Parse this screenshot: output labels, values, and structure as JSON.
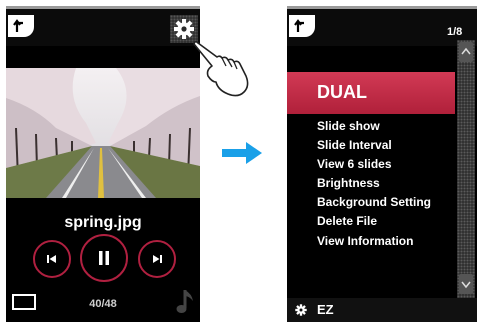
{
  "left_screen": {
    "file_name": "spring.jpg",
    "counter": "40/48",
    "icons": [
      "back-icon",
      "gear-icon",
      "previous-icon",
      "pause-icon",
      "next-icon",
      "slideshow-icon",
      "music-note-icon"
    ]
  },
  "right_screen": {
    "page_indicator": "1/8",
    "menu_title": "DUAL",
    "menu_items": [
      "Slide show",
      "Slide Interval",
      "View 6 slides",
      "Brightness",
      "Background Setting",
      "Delete File",
      "View Information"
    ],
    "bottom_label": "EZ",
    "icons": [
      "back-icon",
      "scroll-up-icon",
      "scroll-down-icon",
      "gear-icon"
    ]
  },
  "colors": {
    "accent": "#c42a45",
    "transition_arrow": "#1aa0e8"
  }
}
